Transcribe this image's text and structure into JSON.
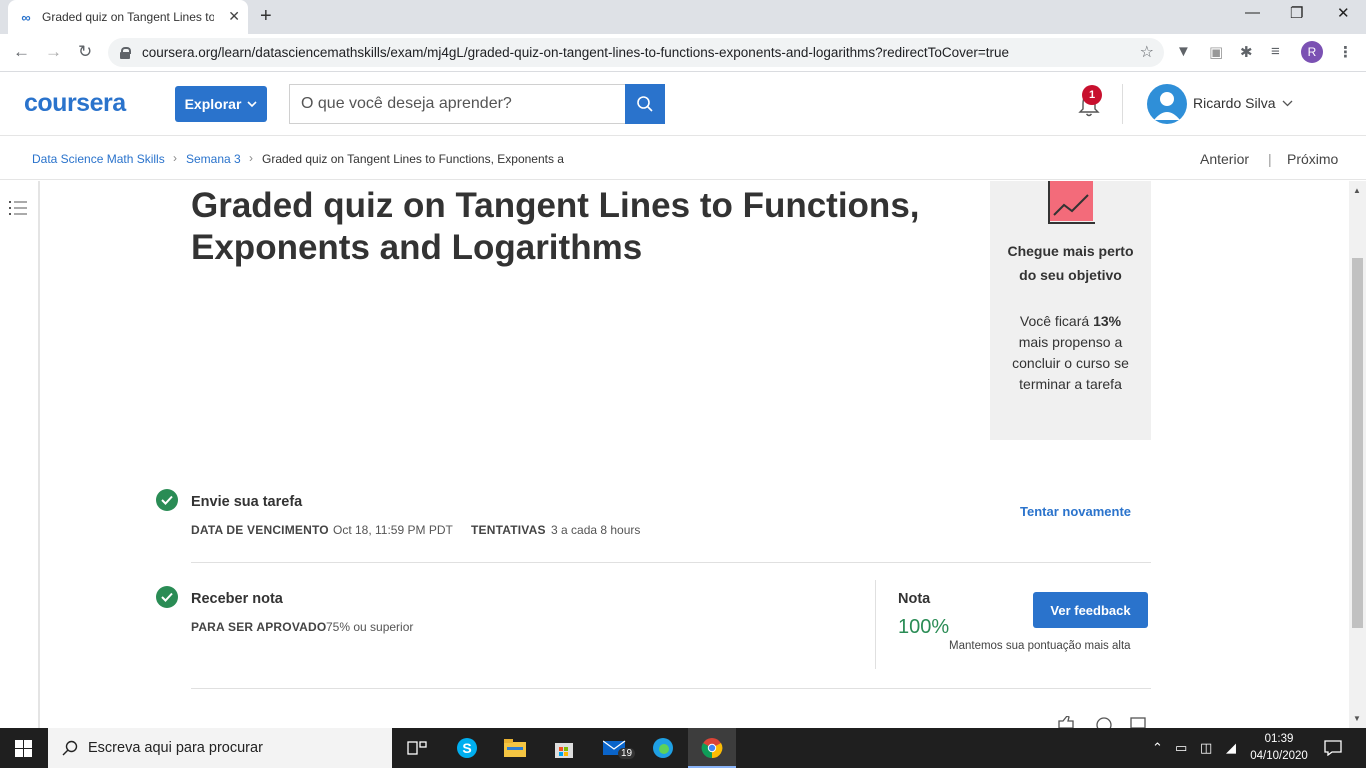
{
  "browser": {
    "tab_title": "Graded quiz on Tangent Lines to Functions, Exponents and Logarithms",
    "tab_favicon": "∞",
    "url": "coursera.org/learn/datasciencemathskills/exam/mj4gL/graded-quiz-on-tangent-lines-to-functions-exponents-and-logarithms?redirectToCover=true",
    "profile_initial": "R",
    "icons": [
      "back-icon",
      "forward-icon",
      "reload-icon",
      "lock-icon",
      "star-icon",
      "extensions-icon",
      "media-icon",
      "menu-icon"
    ]
  },
  "header": {
    "logo": "coursera",
    "explore_label": "Explorar",
    "search_placeholder": "O que você deseja aprender?",
    "notification_count": "1",
    "user_name": "Ricardo Silva",
    "brand_color": "#2a73cc"
  },
  "breadcrumb": {
    "items": [
      "Data Science Math Skills",
      "Semana 3",
      "Graded quiz on Tangent Lines to Functions, Exponents and Logarithms"
    ],
    "prev_label": "Anterior",
    "next_label": "Próximo"
  },
  "main": {
    "title": "Graded quiz on Tangent Lines to Functions, Exponents and Logarithms",
    "goal_card": {
      "heading": "Chegue mais perto do seu objetivo",
      "text_before": "Você ficará ",
      "percent": "13%",
      "text_after": " mais propenso a concluir o curso se terminar a tarefa"
    },
    "submit_step": {
      "title": "Envie sua tarefa",
      "due_label": "DATA DE VENCIMENTO",
      "due_value": "Oct 18, 11:59 PM PDT",
      "attempts_label": "TENTATIVAS",
      "attempts_value": "3 a cada 8 hours",
      "retry_label": "Tentar novamente"
    },
    "grade_step": {
      "title": "Receber nota",
      "pass_label": "PARA SER APROVADO",
      "pass_value": "75% ou superior",
      "grade_label": "Nota",
      "grade_value": "100%",
      "grade_note": "Mantemos sua pontuação mais alta",
      "feedback_label": "Ver feedback",
      "success_color": "#2a8c55"
    }
  },
  "taskbar": {
    "search_placeholder": "Escreva aqui para procurar",
    "mail_badge": "19",
    "time": "01:39",
    "date": "04/10/2020"
  }
}
